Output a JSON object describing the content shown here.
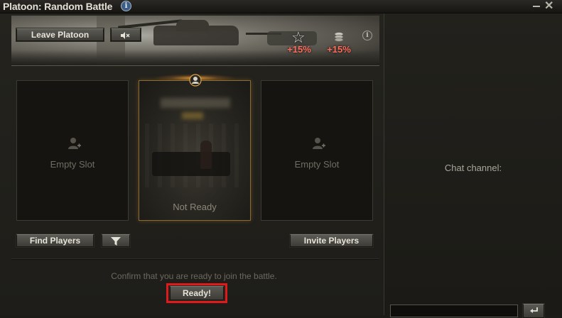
{
  "window": {
    "title": "Platoon: Random Battle",
    "info_icon": "info-icon",
    "minimize_icon": "minimize-icon",
    "close_icon": "close-icon",
    "close_glyph": "✕"
  },
  "banner": {
    "leave_label": "Leave Platoon",
    "mute_icon": "speaker-muted-icon",
    "bonuses": [
      {
        "icon": "star-icon",
        "value": "+15%"
      },
      {
        "icon": "credits-icon",
        "value": "+15%"
      }
    ],
    "info_icon": "info-icon"
  },
  "slots": [
    {
      "state": "empty",
      "label": "Empty Slot",
      "icon": "add-player-icon"
    },
    {
      "state": "occupied",
      "label": "Not Ready",
      "icon": "commander-icon"
    },
    {
      "state": "empty",
      "label": "Empty Slot",
      "icon": "add-player-icon"
    }
  ],
  "actions": {
    "find_label": "Find Players",
    "filter_icon": "filter-icon",
    "invite_label": "Invite Players"
  },
  "confirm": {
    "text": "Confirm that you are ready to join the battle.",
    "ready_label": "Ready!"
  },
  "chat": {
    "label": "Chat channel:",
    "input_value": "",
    "send_icon": "enter-icon"
  },
  "colors": {
    "bonus": "#ff6a5a",
    "highlight": "#e01a1a",
    "slot_active_border": "#8a6a35"
  }
}
